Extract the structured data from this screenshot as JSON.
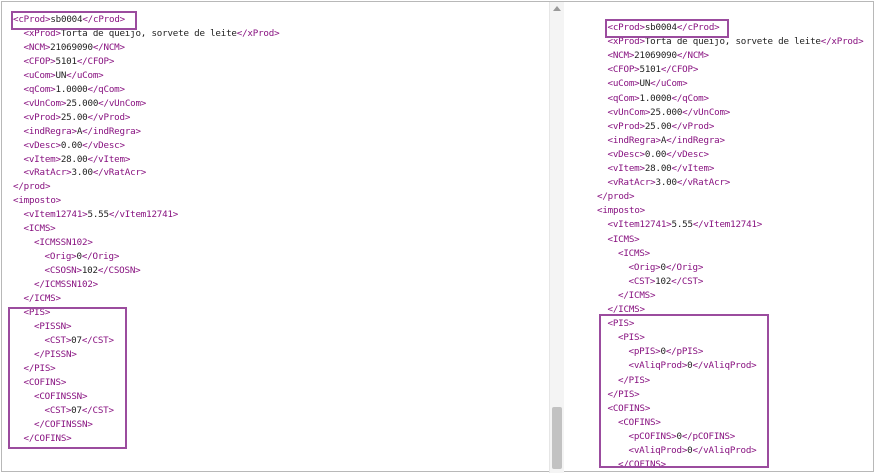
{
  "left_panel": {
    "lines": [
      {
        "indent": 0,
        "text": "<cProd>sb0004</cProd>"
      },
      {
        "indent": 1,
        "text": "<xProd>Torta de queijo, sorvete de leite</xProd>"
      },
      {
        "indent": 1,
        "text": "<NCM>21069090</NCM>"
      },
      {
        "indent": 1,
        "text": "<CFOP>5101</CFOP>"
      },
      {
        "indent": 1,
        "text": "<uCom>UN</uCom>"
      },
      {
        "indent": 1,
        "text": "<qCom>1.0000</qCom>"
      },
      {
        "indent": 1,
        "text": "<vUnCom>25.000</vUnCom>"
      },
      {
        "indent": 1,
        "text": "<vProd>25.00</vProd>"
      },
      {
        "indent": 1,
        "text": "<indRegra>A</indRegra>"
      },
      {
        "indent": 1,
        "text": "<vDesc>0.00</vDesc>"
      },
      {
        "indent": 1,
        "text": "<vItem>28.00</vItem>"
      },
      {
        "indent": 1,
        "text": "<vRatAcr>3.00</vRatAcr>"
      },
      {
        "indent": 0,
        "text": "</prod>"
      },
      {
        "indent": 0,
        "text": "<imposto>"
      },
      {
        "indent": 1,
        "text": "<vItem12741>5.55</vItem12741>"
      },
      {
        "indent": 1,
        "text": "<ICMS>"
      },
      {
        "indent": 2,
        "text": "<ICMSSN102>"
      },
      {
        "indent": 3,
        "text": "<Orig>0</Orig>"
      },
      {
        "indent": 3,
        "text": "<CSOSN>102</CSOSN>"
      },
      {
        "indent": 2,
        "text": "</ICMSSN102>"
      },
      {
        "indent": 1,
        "text": "</ICMS>"
      },
      {
        "indent": 1,
        "text": "<PIS>"
      },
      {
        "indent": 2,
        "text": "<PISSN>"
      },
      {
        "indent": 3,
        "text": "<CST>07</CST>"
      },
      {
        "indent": 2,
        "text": "</PISSN>"
      },
      {
        "indent": 1,
        "text": "</PIS>"
      },
      {
        "indent": 1,
        "text": "<COFINS>"
      },
      {
        "indent": 2,
        "text": "<COFINSSN>"
      },
      {
        "indent": 3,
        "text": "<CST>07</CST>"
      },
      {
        "indent": 2,
        "text": "</COFINSSN>"
      },
      {
        "indent": 1,
        "text": "</COFINS>"
      }
    ]
  },
  "right_panel": {
    "lines": [
      {
        "indent": 1,
        "text": "<cProd>sb0004</cProd>"
      },
      {
        "indent": 1,
        "text": "<xProd>Torta de queijo, sorvete de leite</xProd>"
      },
      {
        "indent": 1,
        "text": "<NCM>21069090</NCM>"
      },
      {
        "indent": 1,
        "text": "<CFOP>5101</CFOP>"
      },
      {
        "indent": 1,
        "text": "<uCom>UN</uCom>"
      },
      {
        "indent": 1,
        "text": "<qCom>1.0000</qCom>"
      },
      {
        "indent": 1,
        "text": "<vUnCom>25.000</vUnCom>"
      },
      {
        "indent": 1,
        "text": "<vProd>25.00</vProd>"
      },
      {
        "indent": 1,
        "text": "<indRegra>A</indRegra>"
      },
      {
        "indent": 1,
        "text": "<vDesc>0.00</vDesc>"
      },
      {
        "indent": 1,
        "text": "<vItem>28.00</vItem>"
      },
      {
        "indent": 1,
        "text": "<vRatAcr>3.00</vRatAcr>"
      },
      {
        "indent": 0,
        "text": "</prod>"
      },
      {
        "indent": 0,
        "text": "<imposto>"
      },
      {
        "indent": 1,
        "text": "<vItem12741>5.55</vItem12741>"
      },
      {
        "indent": 1,
        "text": "<ICMS>"
      },
      {
        "indent": 2,
        "text": "<ICMS>"
      },
      {
        "indent": 3,
        "text": "<Orig>0</Orig>"
      },
      {
        "indent": 3,
        "text": "<CST>102</CST>"
      },
      {
        "indent": 2,
        "text": "</ICMS>"
      },
      {
        "indent": 1,
        "text": "</ICMS>"
      },
      {
        "indent": 1,
        "text": "<PIS>"
      },
      {
        "indent": 2,
        "text": "<PIS>"
      },
      {
        "indent": 3,
        "text": "<pPIS>0</pPIS>"
      },
      {
        "indent": 3,
        "text": "<vAliqProd>0</vAliqProd>"
      },
      {
        "indent": 2,
        "text": "</PIS>"
      },
      {
        "indent": 1,
        "text": "</PIS>"
      },
      {
        "indent": 1,
        "text": "<COFINS>"
      },
      {
        "indent": 2,
        "text": "<COFINS>"
      },
      {
        "indent": 3,
        "text": "<pCOFINS>0</pCOFINS>"
      },
      {
        "indent": 3,
        "text": "<vAliqProd>0</vAliqProd>"
      },
      {
        "indent": 2,
        "text": "</COFINS>"
      }
    ]
  },
  "colors": {
    "tag": "#881280",
    "text": "#222222",
    "highlight_border": "#9b4c9e"
  }
}
